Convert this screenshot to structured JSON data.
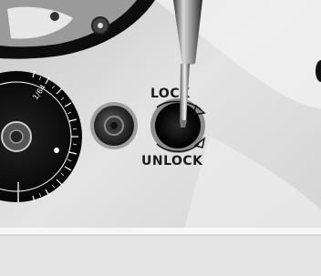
{
  "photo": {
    "label_top": "LOCK",
    "label_bottom": "UNLOCK",
    "dial_label": "1/64",
    "colors": {
      "panel": "#dcdcdc",
      "panel_light": "#eeeeee",
      "dark": "#111111",
      "bottom_band": "#e2e2e2"
    }
  }
}
